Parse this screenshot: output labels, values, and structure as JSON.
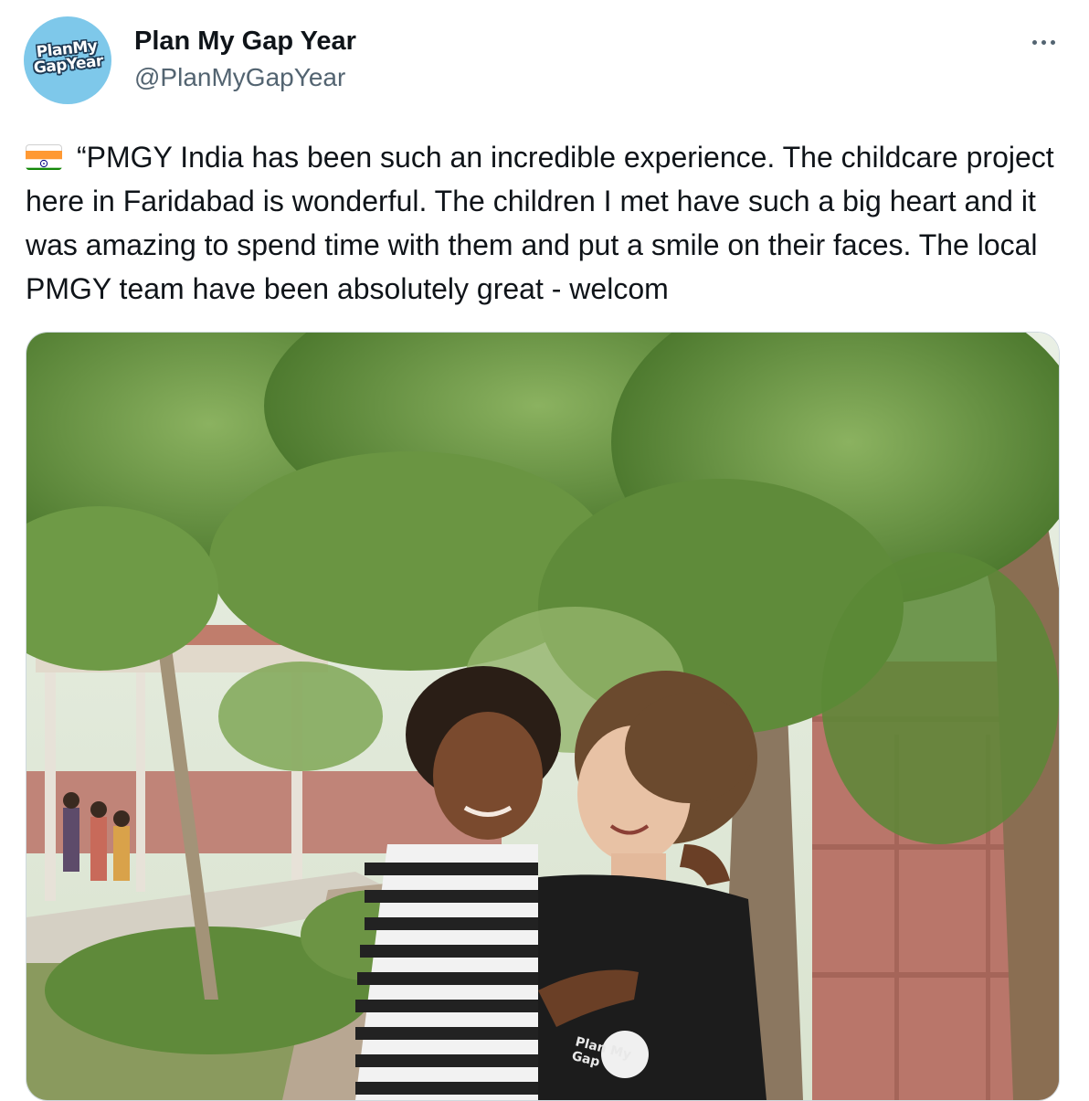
{
  "tweet": {
    "avatar": {
      "logo_text_line1": "PlanMy",
      "logo_text_line2": "GapYear",
      "bg_color": "#7ec8ea"
    },
    "author": {
      "display_name": "Plan My Gap Year",
      "handle": "@PlanMyGapYear"
    },
    "more_icon": "more-horizontal-icon",
    "flag_icon": "flag-india-icon",
    "text": "“PMGY India has been such an incredible experience. The childcare project here in Faridabad is wonderful. The children I met have such a big heart and it was amazing to spend time with them and put a smile on their faces. The local PMGY team have been absolutely great - welcom",
    "media": {
      "shirt_logo_line1": "Plan My",
      "shirt_logo_line2": "Gap"
    }
  }
}
